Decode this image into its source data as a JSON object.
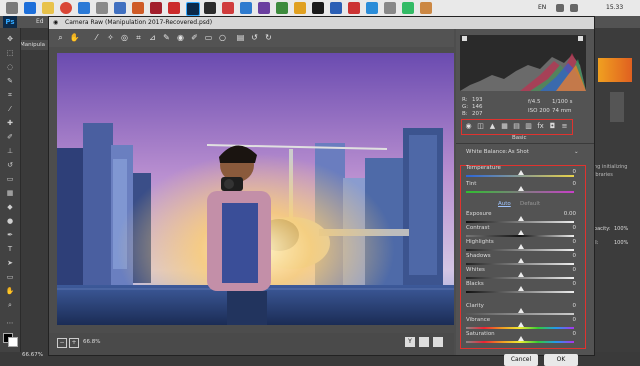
{
  "taskbar": {
    "lang": "EN",
    "time": "15.33"
  },
  "ps": {
    "logo": "Ps",
    "menu_fragment": "Ed",
    "zoom_status": "66.67%",
    "left_tab": "Manipula",
    "right_notes": [
      "ng initializing",
      "ibraries"
    ],
    "right_values": [
      "100%",
      "100%"
    ],
    "right_labels": [
      "Opacity:",
      "Fill:"
    ]
  },
  "dialog": {
    "title": "Camera Raw (Manipulation 2017-Recovered.psd)",
    "zoom": "66.8%",
    "buttons": {
      "cancel": "Cancel",
      "ok": "OK"
    },
    "camera_info": {
      "r_label": "R:",
      "r": "193",
      "g_label": "G:",
      "g": "146",
      "b_label": "B:",
      "b": "207",
      "aperture": "f/4.5",
      "shutter": "1/100 s",
      "iso": "ISO 200",
      "focal": "74 mm"
    },
    "panel_title": "Basic",
    "white_balance_label": "White Balance:",
    "white_balance_value": "As Shot",
    "auto": "Auto",
    "default": "Default",
    "sliders": [
      {
        "label": "Temperature",
        "value": ""
      },
      {
        "label": "Tint",
        "value": "0"
      },
      {
        "label": "Exposure",
        "value": "0.00"
      },
      {
        "label": "Contrast",
        "value": "0"
      },
      {
        "label": "Highlights",
        "value": "0"
      },
      {
        "label": "Shadows",
        "value": "0"
      },
      {
        "label": "Whites",
        "value": "0"
      },
      {
        "label": "Blacks",
        "value": "0"
      },
      {
        "label": "Clarity",
        "value": "0"
      },
      {
        "label": "Vibrance",
        "value": "0"
      },
      {
        "label": "Saturation",
        "value": "0"
      }
    ],
    "temp_value": "0",
    "footer_icons": [
      "Y",
      "compare-icon",
      "settings-icon"
    ]
  },
  "colors": {
    "highlight_box": "#e0332f",
    "ps_blue": "#31a8ff"
  }
}
